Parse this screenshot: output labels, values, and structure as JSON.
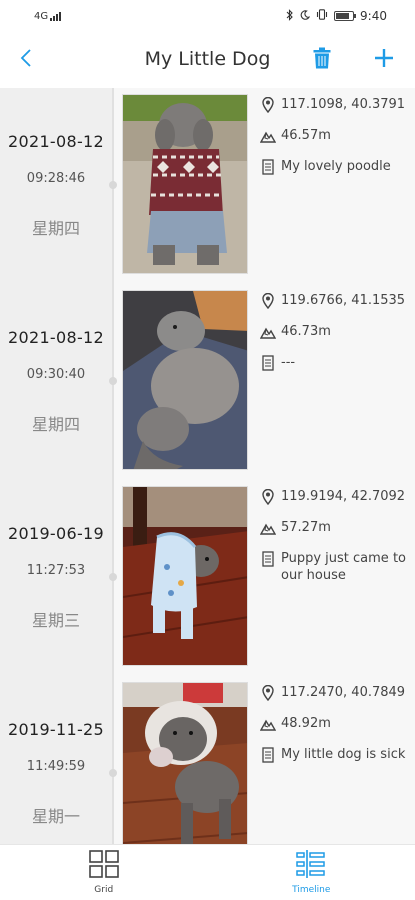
{
  "status_bar": {
    "network": "4G",
    "time": "9:40",
    "icons": [
      "signal-icon",
      "bluetooth-icon",
      "moon-icon",
      "vibrate-icon",
      "battery-icon"
    ]
  },
  "header": {
    "title": "My Little Dog",
    "back_icon": "chevron-left-icon",
    "delete_icon": "trash-icon",
    "add_icon": "plus-icon",
    "accent_color": "#1e9be6"
  },
  "entries": [
    {
      "date": "2021-08-12",
      "time": "09:28:46",
      "weekday": "星期四",
      "coordinates": "117.1098, 40.3791",
      "altitude": "46.57m",
      "note": "My lovely poodle",
      "photo": "poodle-in-sweater"
    },
    {
      "date": "2021-08-12",
      "time": "09:30:40",
      "weekday": "星期四",
      "coordinates": "119.6766, 41.1535",
      "altitude": "46.73m",
      "note": "---",
      "photo": "poodle-sleeping"
    },
    {
      "date": "2019-06-19",
      "time": "11:27:53",
      "weekday": "星期三",
      "coordinates": "119.9194, 42.7092",
      "altitude": "57.27m",
      "note": "Puppy just came to our house",
      "photo": "puppy-in-blue-hoodie"
    },
    {
      "date": "2019-11-25",
      "time": "11:49:59",
      "weekday": "星期一",
      "coordinates": "117.2470, 40.7849",
      "altitude": "48.92m",
      "note": "My little dog is sick",
      "photo": "poodle-with-cone"
    }
  ],
  "bottom_nav": {
    "grid_label": "Grid",
    "timeline_label": "Timeline",
    "active": "Timeline"
  }
}
